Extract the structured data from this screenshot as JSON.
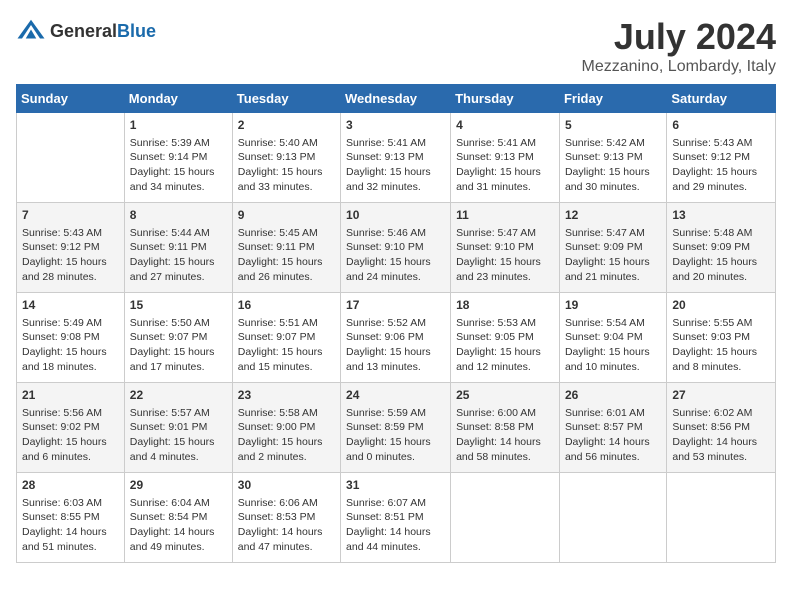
{
  "header": {
    "logo_general": "General",
    "logo_blue": "Blue",
    "month_year": "July 2024",
    "location": "Mezzanino, Lombardy, Italy"
  },
  "days_of_week": [
    "Sunday",
    "Monday",
    "Tuesday",
    "Wednesday",
    "Thursday",
    "Friday",
    "Saturday"
  ],
  "weeks": [
    [
      {
        "day": "",
        "empty": true
      },
      {
        "day": "1",
        "sunrise": "Sunrise: 5:39 AM",
        "sunset": "Sunset: 9:14 PM",
        "daylight": "Daylight: 15 hours and 34 minutes."
      },
      {
        "day": "2",
        "sunrise": "Sunrise: 5:40 AM",
        "sunset": "Sunset: 9:13 PM",
        "daylight": "Daylight: 15 hours and 33 minutes."
      },
      {
        "day": "3",
        "sunrise": "Sunrise: 5:41 AM",
        "sunset": "Sunset: 9:13 PM",
        "daylight": "Daylight: 15 hours and 32 minutes."
      },
      {
        "day": "4",
        "sunrise": "Sunrise: 5:41 AM",
        "sunset": "Sunset: 9:13 PM",
        "daylight": "Daylight: 15 hours and 31 minutes."
      },
      {
        "day": "5",
        "sunrise": "Sunrise: 5:42 AM",
        "sunset": "Sunset: 9:13 PM",
        "daylight": "Daylight: 15 hours and 30 minutes."
      },
      {
        "day": "6",
        "sunrise": "Sunrise: 5:43 AM",
        "sunset": "Sunset: 9:12 PM",
        "daylight": "Daylight: 15 hours and 29 minutes."
      }
    ],
    [
      {
        "day": "7",
        "sunrise": "Sunrise: 5:43 AM",
        "sunset": "Sunset: 9:12 PM",
        "daylight": "Daylight: 15 hours and 28 minutes."
      },
      {
        "day": "8",
        "sunrise": "Sunrise: 5:44 AM",
        "sunset": "Sunset: 9:11 PM",
        "daylight": "Daylight: 15 hours and 27 minutes."
      },
      {
        "day": "9",
        "sunrise": "Sunrise: 5:45 AM",
        "sunset": "Sunset: 9:11 PM",
        "daylight": "Daylight: 15 hours and 26 minutes."
      },
      {
        "day": "10",
        "sunrise": "Sunrise: 5:46 AM",
        "sunset": "Sunset: 9:10 PM",
        "daylight": "Daylight: 15 hours and 24 minutes."
      },
      {
        "day": "11",
        "sunrise": "Sunrise: 5:47 AM",
        "sunset": "Sunset: 9:10 PM",
        "daylight": "Daylight: 15 hours and 23 minutes."
      },
      {
        "day": "12",
        "sunrise": "Sunrise: 5:47 AM",
        "sunset": "Sunset: 9:09 PM",
        "daylight": "Daylight: 15 hours and 21 minutes."
      },
      {
        "day": "13",
        "sunrise": "Sunrise: 5:48 AM",
        "sunset": "Sunset: 9:09 PM",
        "daylight": "Daylight: 15 hours and 20 minutes."
      }
    ],
    [
      {
        "day": "14",
        "sunrise": "Sunrise: 5:49 AM",
        "sunset": "Sunset: 9:08 PM",
        "daylight": "Daylight: 15 hours and 18 minutes."
      },
      {
        "day": "15",
        "sunrise": "Sunrise: 5:50 AM",
        "sunset": "Sunset: 9:07 PM",
        "daylight": "Daylight: 15 hours and 17 minutes."
      },
      {
        "day": "16",
        "sunrise": "Sunrise: 5:51 AM",
        "sunset": "Sunset: 9:07 PM",
        "daylight": "Daylight: 15 hours and 15 minutes."
      },
      {
        "day": "17",
        "sunrise": "Sunrise: 5:52 AM",
        "sunset": "Sunset: 9:06 PM",
        "daylight": "Daylight: 15 hours and 13 minutes."
      },
      {
        "day": "18",
        "sunrise": "Sunrise: 5:53 AM",
        "sunset": "Sunset: 9:05 PM",
        "daylight": "Daylight: 15 hours and 12 minutes."
      },
      {
        "day": "19",
        "sunrise": "Sunrise: 5:54 AM",
        "sunset": "Sunset: 9:04 PM",
        "daylight": "Daylight: 15 hours and 10 minutes."
      },
      {
        "day": "20",
        "sunrise": "Sunrise: 5:55 AM",
        "sunset": "Sunset: 9:03 PM",
        "daylight": "Daylight: 15 hours and 8 minutes."
      }
    ],
    [
      {
        "day": "21",
        "sunrise": "Sunrise: 5:56 AM",
        "sunset": "Sunset: 9:02 PM",
        "daylight": "Daylight: 15 hours and 6 minutes."
      },
      {
        "day": "22",
        "sunrise": "Sunrise: 5:57 AM",
        "sunset": "Sunset: 9:01 PM",
        "daylight": "Daylight: 15 hours and 4 minutes."
      },
      {
        "day": "23",
        "sunrise": "Sunrise: 5:58 AM",
        "sunset": "Sunset: 9:00 PM",
        "daylight": "Daylight: 15 hours and 2 minutes."
      },
      {
        "day": "24",
        "sunrise": "Sunrise: 5:59 AM",
        "sunset": "Sunset: 8:59 PM",
        "daylight": "Daylight: 15 hours and 0 minutes."
      },
      {
        "day": "25",
        "sunrise": "Sunrise: 6:00 AM",
        "sunset": "Sunset: 8:58 PM",
        "daylight": "Daylight: 14 hours and 58 minutes."
      },
      {
        "day": "26",
        "sunrise": "Sunrise: 6:01 AM",
        "sunset": "Sunset: 8:57 PM",
        "daylight": "Daylight: 14 hours and 56 minutes."
      },
      {
        "day": "27",
        "sunrise": "Sunrise: 6:02 AM",
        "sunset": "Sunset: 8:56 PM",
        "daylight": "Daylight: 14 hours and 53 minutes."
      }
    ],
    [
      {
        "day": "28",
        "sunrise": "Sunrise: 6:03 AM",
        "sunset": "Sunset: 8:55 PM",
        "daylight": "Daylight: 14 hours and 51 minutes."
      },
      {
        "day": "29",
        "sunrise": "Sunrise: 6:04 AM",
        "sunset": "Sunset: 8:54 PM",
        "daylight": "Daylight: 14 hours and 49 minutes."
      },
      {
        "day": "30",
        "sunrise": "Sunrise: 6:06 AM",
        "sunset": "Sunset: 8:53 PM",
        "daylight": "Daylight: 14 hours and 47 minutes."
      },
      {
        "day": "31",
        "sunrise": "Sunrise: 6:07 AM",
        "sunset": "Sunset: 8:51 PM",
        "daylight": "Daylight: 14 hours and 44 minutes."
      },
      {
        "day": "",
        "empty": true
      },
      {
        "day": "",
        "empty": true
      },
      {
        "day": "",
        "empty": true
      }
    ]
  ]
}
